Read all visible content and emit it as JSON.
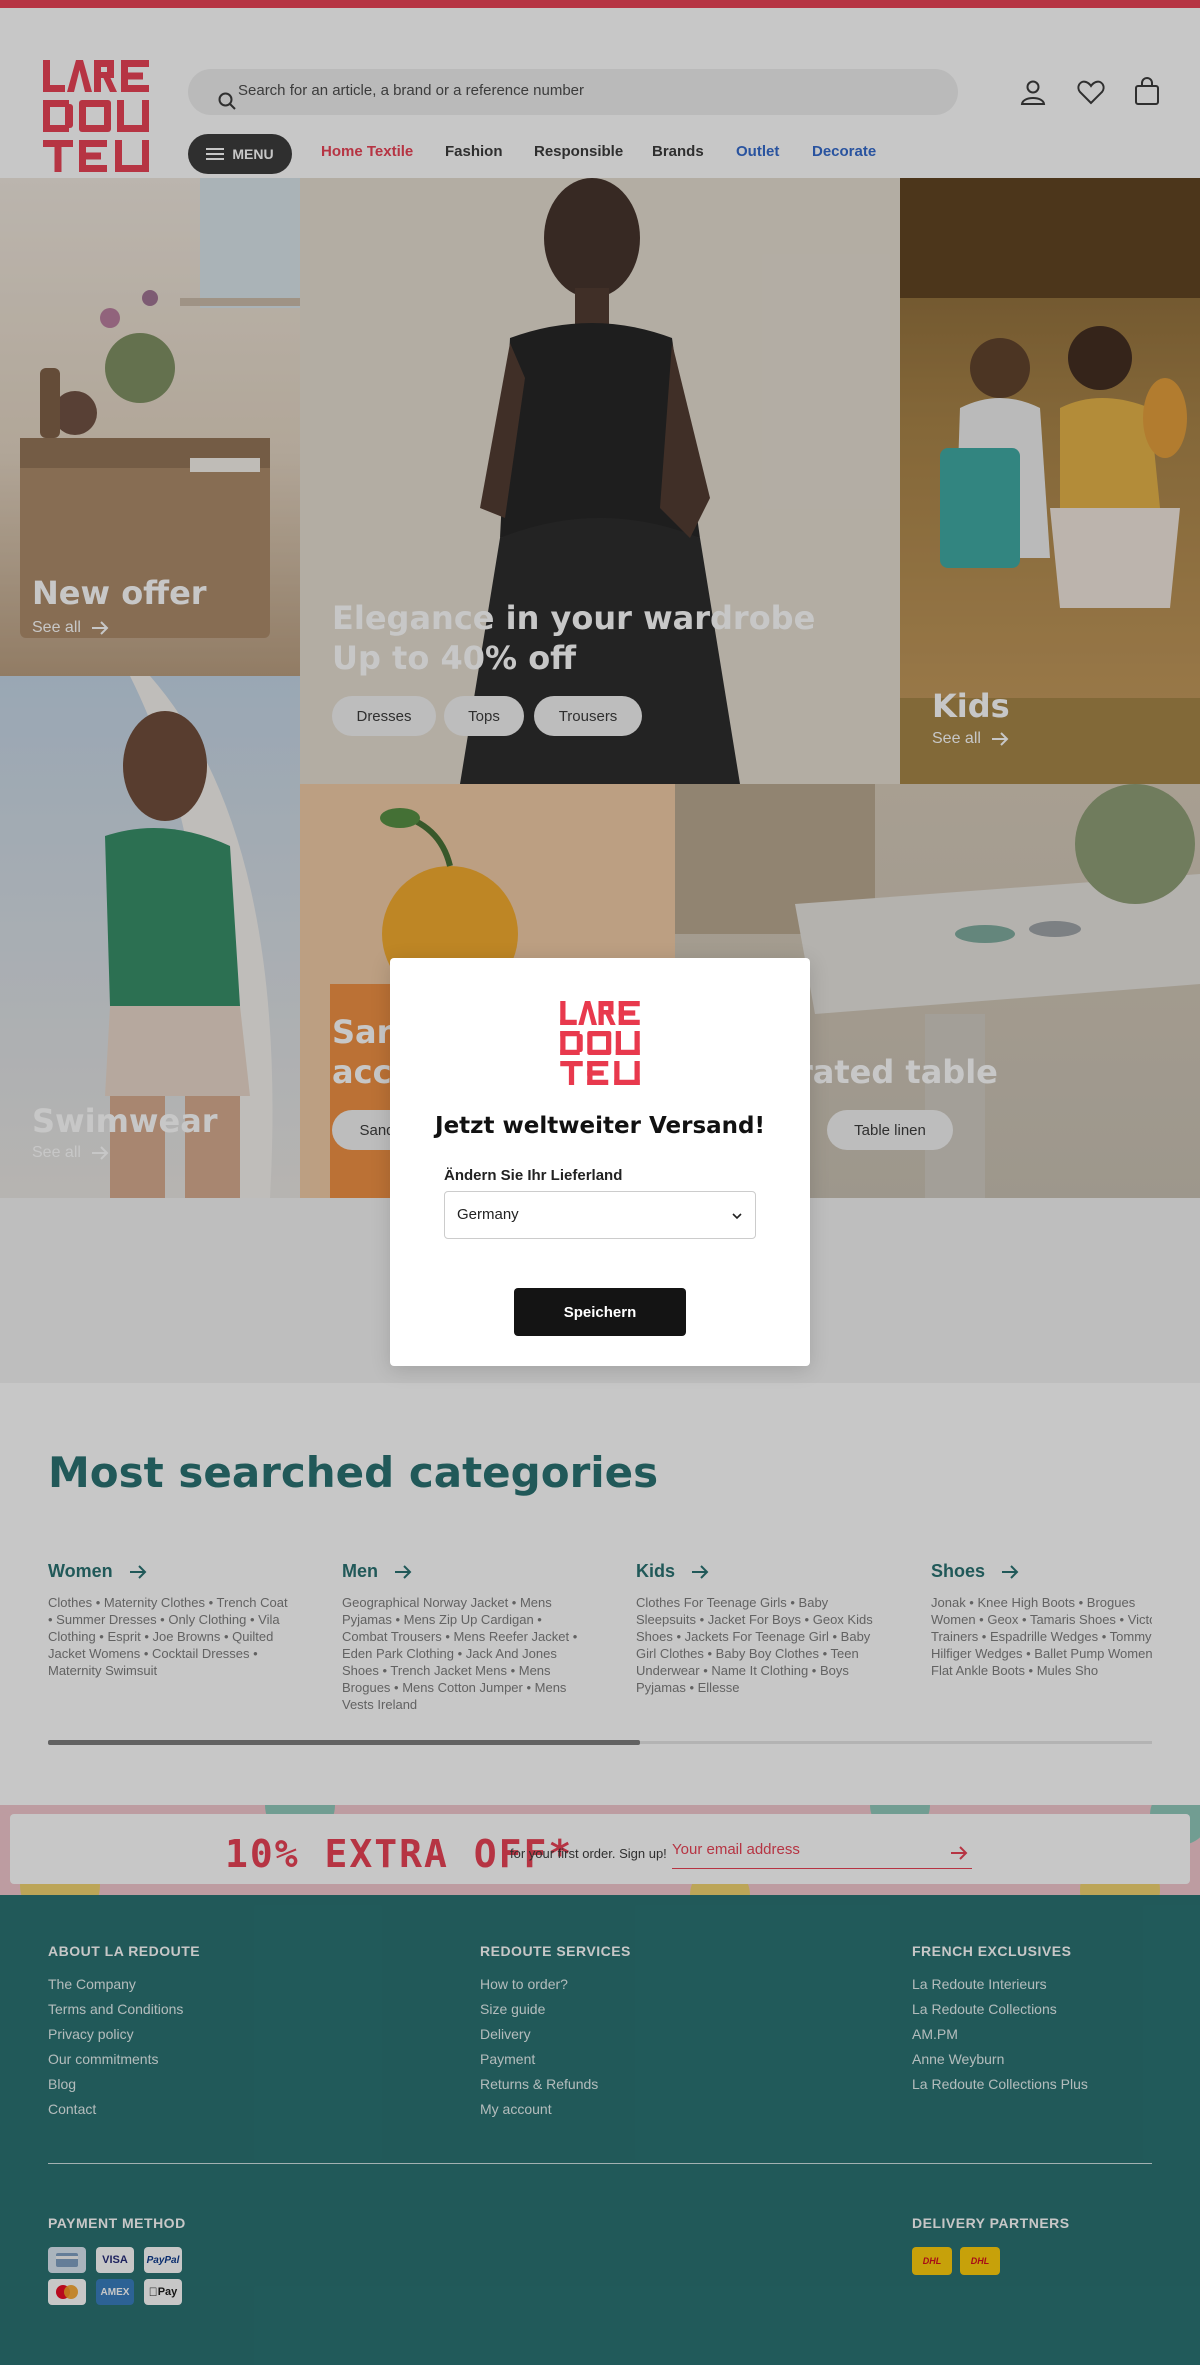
{
  "header": {
    "search_placeholder": "Search for an article, a brand or a reference number",
    "menu_label": "MENU",
    "nav": [
      "Home Textile",
      "Fashion",
      "Responsible",
      "Brands",
      "Outlet",
      "Decorate"
    ]
  },
  "hero": {
    "new_offer": {
      "title": "New offer",
      "see_all": "See all"
    },
    "elegance": {
      "title_1": "Elegance in your wardrobe",
      "title_2": "Up to 40% off",
      "pills": [
        "Dresses",
        "Tops",
        "Trousers"
      ]
    },
    "kids": {
      "title": "Kids",
      "see_all": "See all"
    },
    "swimwear": {
      "title": "Swimwear",
      "see_all": "See all"
    },
    "sandals": {
      "title_1": "San",
      "title_2": "acc",
      "pill": "Sand"
    },
    "table": {
      "title": "orated table",
      "pill": "Table linen"
    }
  },
  "modal": {
    "title": "Jetzt weltweiter Versand!",
    "label": "Ändern Sie Ihr Lieferland",
    "country": "Germany",
    "save": "Speichern"
  },
  "categories": {
    "heading": "Most searched categories",
    "columns": [
      {
        "title": "Women",
        "links": "Clothes • Maternity Clothes • Trench Coat • Summer Dresses • Only Clothing • Vila Clothing • Esprit • Joe Browns • Quilted Jacket Womens • Cocktail Dresses • Maternity Swimsuit"
      },
      {
        "title": "Men",
        "links": "Geographical Norway Jacket • Mens Pyjamas • Mens Zip Up Cardigan • Combat Trousers • Mens Reefer Jacket • Eden Park Clothing • Jack And Jones Shoes • Trench Jacket Mens • Mens Brogues • Mens Cotton Jumper • Mens Vests Ireland"
      },
      {
        "title": "Kids",
        "links": "Clothes For Teenage Girls • Baby Sleepsuits • Jacket For Boys • Geox Kids Shoes • Jackets For Teenage Girl • Baby Girl Clothes • Baby Boy Clothes • Teen Underwear • Name It Clothing • Boys Pyjamas • Ellesse"
      },
      {
        "title": "Shoes",
        "links": "Jonak • Knee High Boots • Brogues Women • Geox • Tamaris Shoes • Victoria Trainers • Espadrille Wedges • Tommy Hilfiger Wedges • Ballet Pump Womens Flat Ankle Boots • Mules Sho"
      }
    ],
    "scroll_fraction": 0.536
  },
  "newsletter": {
    "headline": "10% EXTRA OFF*",
    "text": "for your first order. Sign up!",
    "email_placeholder": "Your email address"
  },
  "footer": {
    "about": {
      "heading": "ABOUT LA REDOUTE",
      "links": [
        "The Company",
        "Terms and Conditions",
        "Privacy policy",
        "Our commitments",
        "Blog",
        "Contact"
      ]
    },
    "services": {
      "heading": "REDOUTE SERVICES",
      "links": [
        "How to order?",
        "Size guide",
        "Delivery",
        "Payment",
        "Returns & Refunds",
        "My account"
      ]
    },
    "exclusives": {
      "heading": "FRENCH EXCLUSIVES",
      "links": [
        "La Redoute Interieurs",
        "La Redoute Collections",
        "AM.PM",
        "Anne Weyburn",
        "La Redoute Collections Plus"
      ]
    },
    "payment_heading": "PAYMENT METHOD",
    "payment_methods": [
      "VISA",
      "PayPal",
      "AMEX",
      "Pay"
    ],
    "delivery_heading": "DELIVERY PARTNERS",
    "delivery_partners": [
      "DHL",
      "DHL"
    ]
  },
  "colors": {
    "brand_red": "#e8394d",
    "teal": "#1f6b6b",
    "nav_red": "#e8394d",
    "nav_blue": "#2a63c9"
  }
}
